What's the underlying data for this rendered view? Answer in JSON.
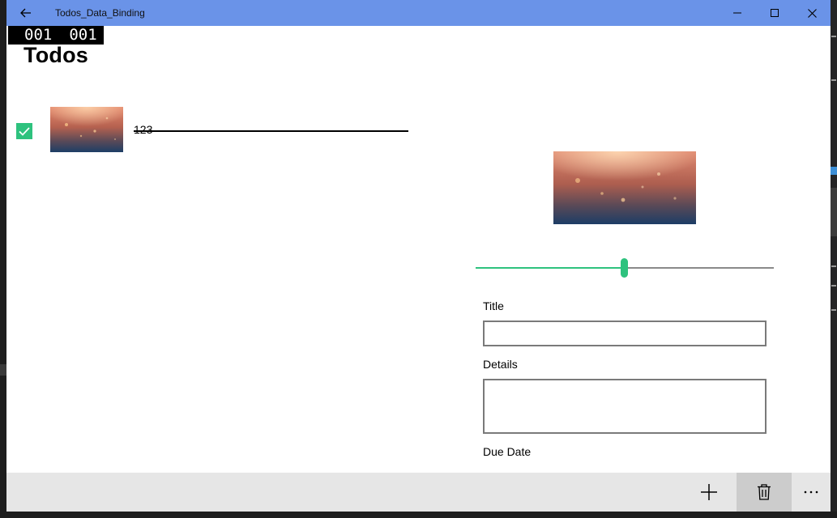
{
  "window": {
    "title": "Todos_Data_Binding",
    "accent": "#6a93e8"
  },
  "counter": {
    "left": "001",
    "right": "001"
  },
  "page": {
    "title": "Todos"
  },
  "todos": [
    {
      "title": "123",
      "completed": true,
      "image": "bokeh-lights-thumbnail"
    }
  ],
  "detail": {
    "image": "bokeh-lights-image",
    "slider_fraction": 0.5,
    "title_label": "Title",
    "title_value": "",
    "details_label": "Details",
    "details_value": "",
    "due_date_label": "Due Date"
  },
  "appbar": {
    "buttons": [
      "add-icon",
      "delete-icon",
      "more-icon"
    ]
  },
  "colors": {
    "check": "#2ec27e",
    "slider": "#2ec27e",
    "appbar": "#e6e6e6"
  }
}
